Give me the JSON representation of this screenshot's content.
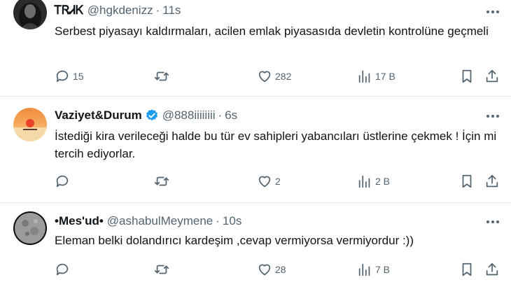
{
  "tweets": [
    {
      "display_name": "ᎢᏒᏗᏦ",
      "handle": "@hgkdenizz",
      "separator": "·",
      "time": "11s",
      "verified": false,
      "text": "Serbest piyasayı kaldırmaları, acilen emlak piyasasıda devletin kontrolüne geçmeli",
      "replies": "15",
      "reposts": "",
      "likes": "282",
      "views": "17 B"
    },
    {
      "display_name": "Vaziyet&Durum",
      "handle": "@888iiiiiiii",
      "separator": "·",
      "time": "6s",
      "verified": true,
      "text": "İstediği kira verileceği halde bu tür ev sahipleri  yabancıları üstlerine çekmek ! İçin mi tercih ediyorlar.",
      "replies": "",
      "reposts": "",
      "likes": "2",
      "views": "2 B"
    },
    {
      "display_name": "•Mes'ud•",
      "handle": "@ashabulMeymene",
      "separator": "·",
      "time": "10s",
      "verified": false,
      "text": "Eleman belki dolandırıcı kardeşim ,cevap vermiyorsa vermiyordur :))",
      "replies": "",
      "reposts": "",
      "likes": "28",
      "views": "7 B"
    }
  ],
  "colors": {
    "text_primary": "#0f1419",
    "text_secondary": "#536471",
    "verified_blue": "#1d9bf0",
    "divider": "#e7e9ea"
  }
}
